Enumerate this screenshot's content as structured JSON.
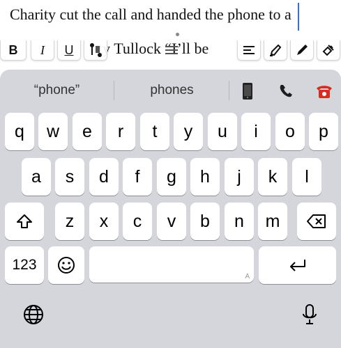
{
  "document": {
    "line1": "Charity cut the call and handed the phone to a",
    "line2": "ty Tullock “I’ll be"
  },
  "format_toolbar": {
    "bold": "B",
    "italic": "I",
    "underline": "U"
  },
  "suggestions": {
    "items": [
      "“phone”",
      "phones"
    ],
    "emoji": [
      "mobile-phone-emoji",
      "telephone-receiver-emoji",
      "red-telephone-emoji"
    ]
  },
  "keyboard": {
    "row1": [
      "q",
      "w",
      "e",
      "r",
      "t",
      "y",
      "u",
      "i",
      "o",
      "p"
    ],
    "row2": [
      "a",
      "s",
      "d",
      "f",
      "g",
      "h",
      "j",
      "k",
      "l"
    ],
    "row3": [
      "z",
      "x",
      "c",
      "v",
      "b",
      "n",
      "m"
    ],
    "numbers_label": "123",
    "space_mark": "A"
  },
  "colors": {
    "keyboard_bg": "#d4d6db",
    "key_bg": "#ffffff",
    "caret": "#2f6fe0"
  }
}
